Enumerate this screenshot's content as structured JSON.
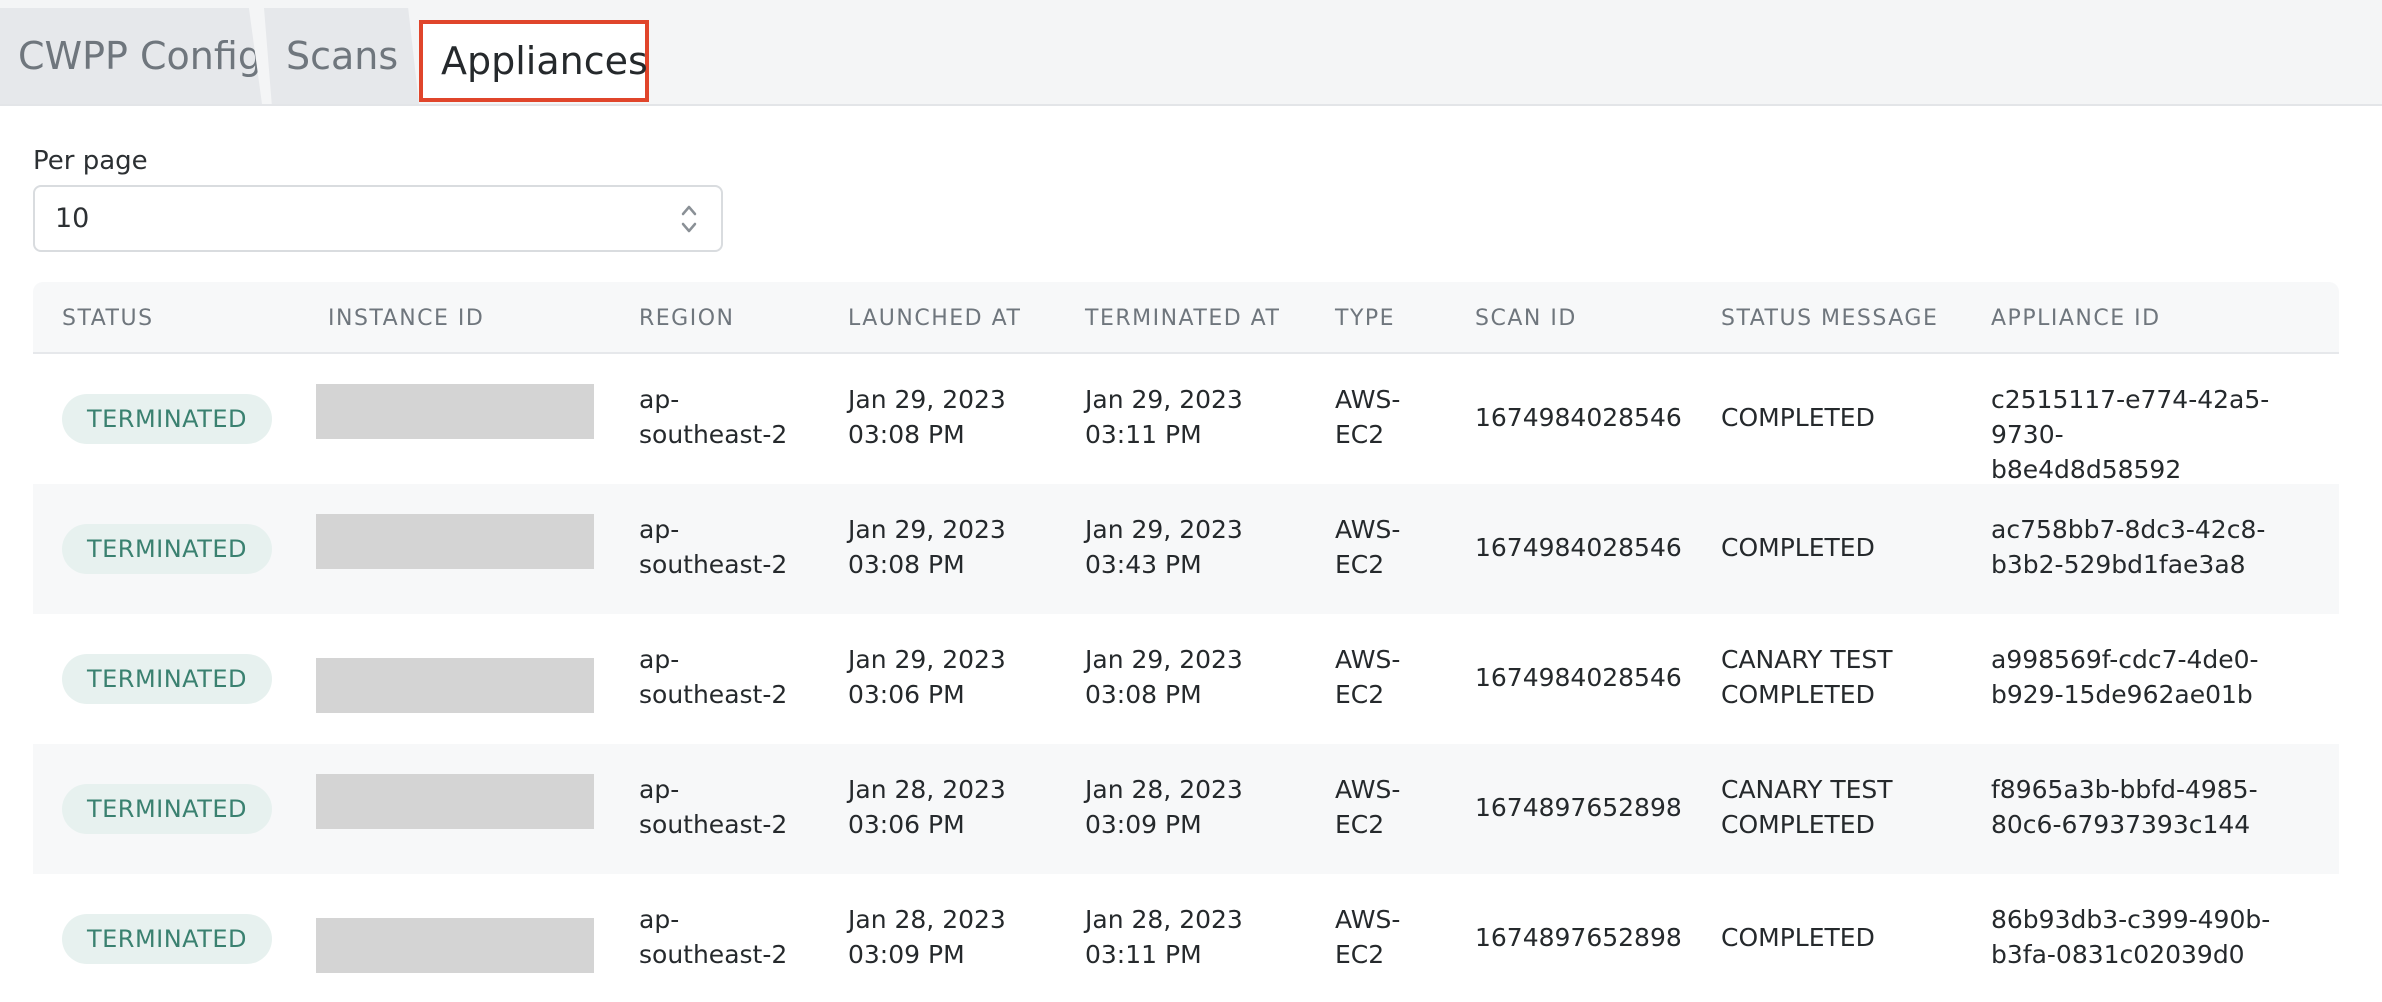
{
  "tabs": [
    {
      "label": "CWPP Config"
    },
    {
      "label": "Scans"
    },
    {
      "label": "Appliances"
    }
  ],
  "per_page": {
    "label": "Per page",
    "value": "10"
  },
  "table": {
    "headers": [
      "STATUS",
      "INSTANCE ID",
      "REGION",
      "LAUNCHED AT",
      "TERMINATED AT",
      "TYPE",
      "SCAN ID",
      "STATUS MESSAGE",
      "APPLIANCE ID"
    ],
    "rows": [
      {
        "status": "TERMINATED",
        "region": [
          "ap-",
          "southeast-2"
        ],
        "launched": [
          "Jan 29, 2023",
          "03:08 PM"
        ],
        "terminated": [
          "Jan 29, 2023",
          "03:11 PM"
        ],
        "type": [
          "AWS-",
          "EC2"
        ],
        "scan_id": "1674984028546",
        "message": [
          "COMPLETED"
        ],
        "appliance_id": [
          "c2515117-e774-42a5-9730-",
          "b8e4d8d58592"
        ]
      },
      {
        "status": "TERMINATED",
        "region": [
          "ap-",
          "southeast-2"
        ],
        "launched": [
          "Jan 29, 2023",
          "03:08 PM"
        ],
        "terminated": [
          "Jan 29, 2023",
          "03:43 PM"
        ],
        "type": [
          "AWS-",
          "EC2"
        ],
        "scan_id": "1674984028546",
        "message": [
          "COMPLETED"
        ],
        "appliance_id": [
          "ac758bb7-8dc3-42c8-",
          "b3b2-529bd1fae3a8"
        ]
      },
      {
        "status": "TERMINATED",
        "region": [
          "ap-",
          "southeast-2"
        ],
        "launched": [
          "Jan 29, 2023",
          "03:06 PM"
        ],
        "terminated": [
          "Jan 29, 2023",
          "03:08 PM"
        ],
        "type": [
          "AWS-",
          "EC2"
        ],
        "scan_id": "1674984028546",
        "message": [
          "CANARY TEST",
          "COMPLETED"
        ],
        "appliance_id": [
          "a998569f-cdc7-4de0-",
          "b929-15de962ae01b"
        ]
      },
      {
        "status": "TERMINATED",
        "region": [
          "ap-",
          "southeast-2"
        ],
        "launched": [
          "Jan 28, 2023",
          "03:06 PM"
        ],
        "terminated": [
          "Jan 28, 2023",
          "03:09 PM"
        ],
        "type": [
          "AWS-",
          "EC2"
        ],
        "scan_id": "1674897652898",
        "message": [
          "CANARY TEST",
          "COMPLETED"
        ],
        "appliance_id": [
          "f8965a3b-bbfd-4985-",
          "80c6-67937393c144"
        ]
      },
      {
        "status": "TERMINATED",
        "region": [
          "ap-",
          "southeast-2"
        ],
        "launched": [
          "Jan 28, 2023",
          "03:09 PM"
        ],
        "terminated": [
          "Jan 28, 2023",
          "03:11 PM"
        ],
        "type": [
          "AWS-",
          "EC2"
        ],
        "scan_id": "1674897652898",
        "message": [
          "COMPLETED"
        ],
        "appliance_id": [
          "86b93db3-c399-490b-",
          "b3fa-0831c02039d0"
        ]
      }
    ]
  }
}
